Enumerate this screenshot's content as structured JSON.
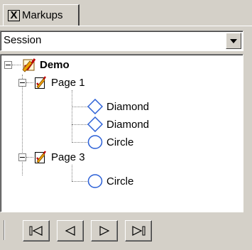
{
  "tab": {
    "label": "Markups",
    "close_glyph": "X"
  },
  "session_select": {
    "value": "Session"
  },
  "tree": {
    "root": {
      "label": "Demo"
    },
    "pages": [
      {
        "label": "Page 1",
        "children": [
          "Diamond",
          "Diamond",
          "Circle"
        ]
      },
      {
        "label": "Page 3",
        "children": [
          "Circle"
        ]
      }
    ]
  },
  "icons": {
    "root": "markup-document-icon",
    "page": "page-icon",
    "diamond": "diamond-icon",
    "circle": "circle-icon"
  },
  "navigation": [
    "first-button",
    "previous-button",
    "next-button",
    "last-button"
  ],
  "colors": {
    "shape_blue": "#2a5fd6",
    "panel": "#d4d0c8",
    "pencil": "#f2a100",
    "check": "#c00000"
  }
}
